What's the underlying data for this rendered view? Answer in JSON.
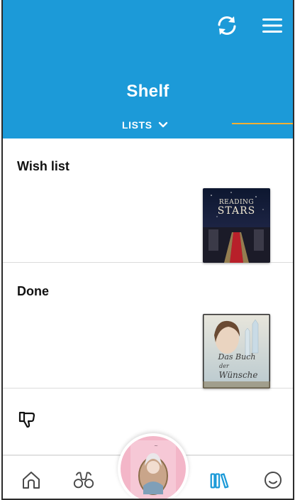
{
  "header": {
    "title": "Shelf",
    "lists_tab_label": "LISTS",
    "background_color": "#1c9ad8",
    "indicator_color": "#f2b033"
  },
  "sections": [
    {
      "title": "Wish list",
      "book": {
        "cover_title_line1": "READING",
        "cover_title_line2": "STARS"
      }
    },
    {
      "title": "Done",
      "book": {
        "cover_title_line1": "Das Buch",
        "cover_title_line2": "der",
        "cover_title_line3": "Wünsche"
      }
    },
    {
      "title": "",
      "icon": "thumbs-down-icon"
    }
  ],
  "nav": {
    "items": [
      {
        "icon": "home-icon"
      },
      {
        "icon": "binoculars-icon"
      },
      {
        "icon": "current-book-cover"
      },
      {
        "icon": "books-icon",
        "active": true
      },
      {
        "icon": "smiley-icon"
      }
    ],
    "active_color": "#1c9ad8",
    "inactive_color": "#4a4a4a"
  }
}
